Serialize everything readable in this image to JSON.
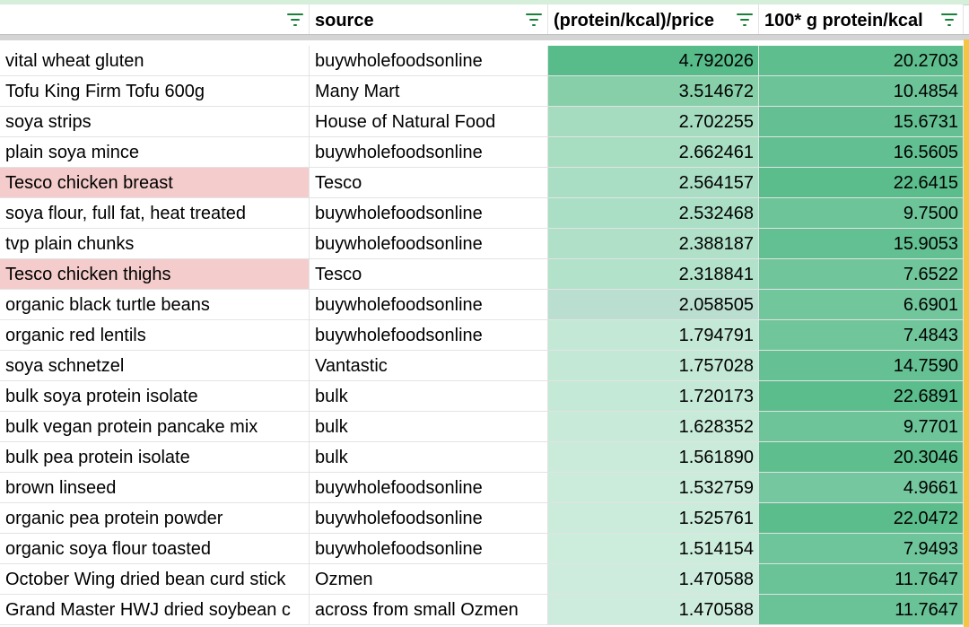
{
  "headers": [
    "",
    "source",
    "(protein/kcal)/price",
    "100* g protein/kcal"
  ],
  "colors": {
    "header_text": "#000000",
    "filter_icon": "#188038",
    "highlight_red": "#f4cccc",
    "grid": "#e2e3e3",
    "right_edge": "#f4c542"
  },
  "rows": [
    {
      "name": "vital wheat gluten",
      "source": "buywholefoodsonline",
      "ratio": "4.792026",
      "protein": "20.2703",
      "ratio_fill": "#57bb8a",
      "protein_fill": "#5ebe8e",
      "highlight": false
    },
    {
      "name": "Tofu King Firm Tofu 600g",
      "source": "Many Mart",
      "ratio": "3.514672",
      "protein": "10.4854",
      "ratio_fill": "#86cfa9",
      "protein_fill": "#6cc398",
      "highlight": false
    },
    {
      "name": "soya strips",
      "source": "House of Natural Food",
      "ratio": "2.702255",
      "protein": "15.6731",
      "ratio_fill": "#a5dcc0",
      "protein_fill": "#64c093",
      "highlight": false
    },
    {
      "name": "plain soya mince",
      "source": "buywholefoodsonline",
      "ratio": "2.662461",
      "protein": "16.5605",
      "ratio_fill": "#a7ddc1",
      "protein_fill": "#62bf92",
      "highlight": false
    },
    {
      "name": "Tesco chicken breast",
      "source": "Tesco",
      "ratio": "2.564157",
      "protein": "22.6415",
      "ratio_fill": "#aadec4",
      "protein_fill": "#5bbd8c",
      "highlight": true
    },
    {
      "name": "soya flour, full fat, heat treated",
      "source": "buywholefoodsonline",
      "ratio": "2.532468",
      "protein": "9.7500",
      "ratio_fill": "#abdfc5",
      "protein_fill": "#6dc499",
      "highlight": false
    },
    {
      "name": "tvp plain chunks",
      "source": "buywholefoodsonline",
      "ratio": "2.388187",
      "protein": "15.9053",
      "ratio_fill": "#b0e1c8",
      "protein_fill": "#63c093",
      "highlight": false
    },
    {
      "name": "Tesco chicken thighs",
      "source": "Tesco",
      "ratio": "2.318841",
      "protein": "7.6522",
      "ratio_fill": "#b2e2ca",
      "protein_fill": "#70c59b",
      "highlight": true
    },
    {
      "name": "organic black turtle beans",
      "source": "buywholefoodsonline",
      "ratio": "2.058505",
      "protein": "6.6901",
      "ratio_fill": "#badfd0",
      "protein_fill": "#71c69c",
      "highlight": false
    },
    {
      "name": "organic red lentils",
      "source": "buywholefoodsonline",
      "ratio": "1.794791",
      "protein": "7.4843",
      "ratio_fill": "#c3e8d5",
      "protein_fill": "#70c59b",
      "highlight": false
    },
    {
      "name": "soya schnetzel",
      "source": "Vantastic",
      "ratio": "1.757028",
      "protein": "14.7590",
      "ratio_fill": "#c4e8d6",
      "protein_fill": "#65c194",
      "highlight": false
    },
    {
      "name": "bulk soya protein isolate",
      "source": "bulk",
      "ratio": "1.720173",
      "protein": "22.6891",
      "ratio_fill": "#c5e9d7",
      "protein_fill": "#5bbd8c",
      "highlight": false
    },
    {
      "name": "bulk vegan protein pancake mix",
      "source": "bulk",
      "ratio": "1.628352",
      "protein": "9.7701",
      "ratio_fill": "#c8ead9",
      "protein_fill": "#6dc499",
      "highlight": false
    },
    {
      "name": "bulk pea protein isolate",
      "source": "bulk",
      "ratio": "1.561890",
      "protein": "20.3046",
      "ratio_fill": "#caebda",
      "protein_fill": "#5ebe8e",
      "highlight": false
    },
    {
      "name": "brown linseed",
      "source": "buywholefoodsonline",
      "ratio": "1.532759",
      "protein": "4.9661",
      "ratio_fill": "#cbebdb",
      "protein_fill": "#74c79e",
      "highlight": false
    },
    {
      "name": "organic pea protein powder",
      "source": "buywholefoodsonline",
      "ratio": "1.525761",
      "protein": "22.0472",
      "ratio_fill": "#cbebdb",
      "protein_fill": "#5bbd8c",
      "highlight": false
    },
    {
      "name": "organic soya flour toasted",
      "source": "buywholefoodsonline",
      "ratio": "1.514154",
      "protein": "7.9493",
      "ratio_fill": "#ccecdc",
      "protein_fill": "#6fc59b",
      "highlight": false
    },
    {
      "name": "October Wing dried bean curd stick",
      "source": "Ozmen",
      "ratio": "1.470588",
      "protein": "11.7647",
      "ratio_fill": "#cdecdd",
      "protein_fill": "#6ac297",
      "highlight": false
    },
    {
      "name": "Grand Master HWJ dried soybean c",
      "source": "across from small Ozmen",
      "ratio": "1.470588",
      "protein": "11.7647",
      "ratio_fill": "#cdecdd",
      "protein_fill": "#6ac297",
      "highlight": false
    }
  ]
}
